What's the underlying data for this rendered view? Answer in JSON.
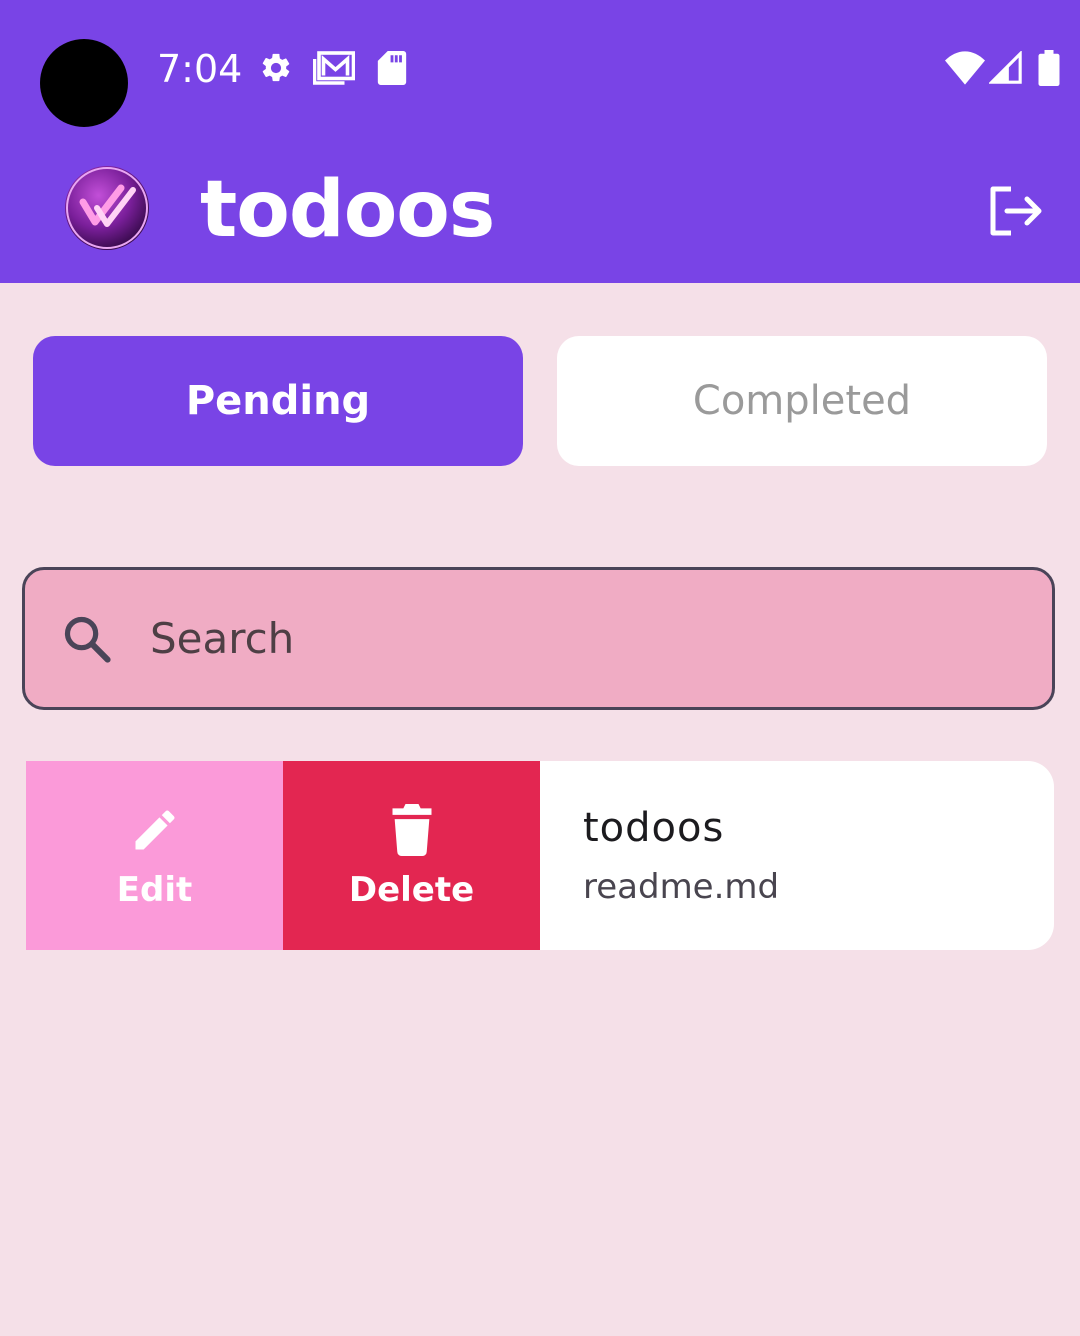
{
  "status_bar": {
    "time": "7:04",
    "icons": [
      "gear-icon",
      "gallery-mail-icon",
      "sd-card-icon",
      "wifi-icon",
      "cell-signal-icon",
      "battery-icon"
    ]
  },
  "header": {
    "title": "todoos",
    "logo": "double-check-logo",
    "logout_icon": "logout-icon"
  },
  "tabs": [
    {
      "label": "Pending",
      "selected": true
    },
    {
      "label": "Completed",
      "selected": false
    }
  ],
  "search": {
    "placeholder": "Search",
    "value": ""
  },
  "list": {
    "items": [
      {
        "title": "todoos",
        "subtitle": "readme.md",
        "actions": [
          {
            "label": "Edit",
            "icon": "pencil-icon"
          },
          {
            "label": "Delete",
            "icon": "trash-icon"
          }
        ]
      }
    ]
  },
  "colors": {
    "primary": "#7944e6",
    "background": "#f5e0e8",
    "search_fill": "#f0acc4",
    "edit": "#fb9ad9",
    "delete": "#e32651",
    "card": "#ffffff"
  }
}
